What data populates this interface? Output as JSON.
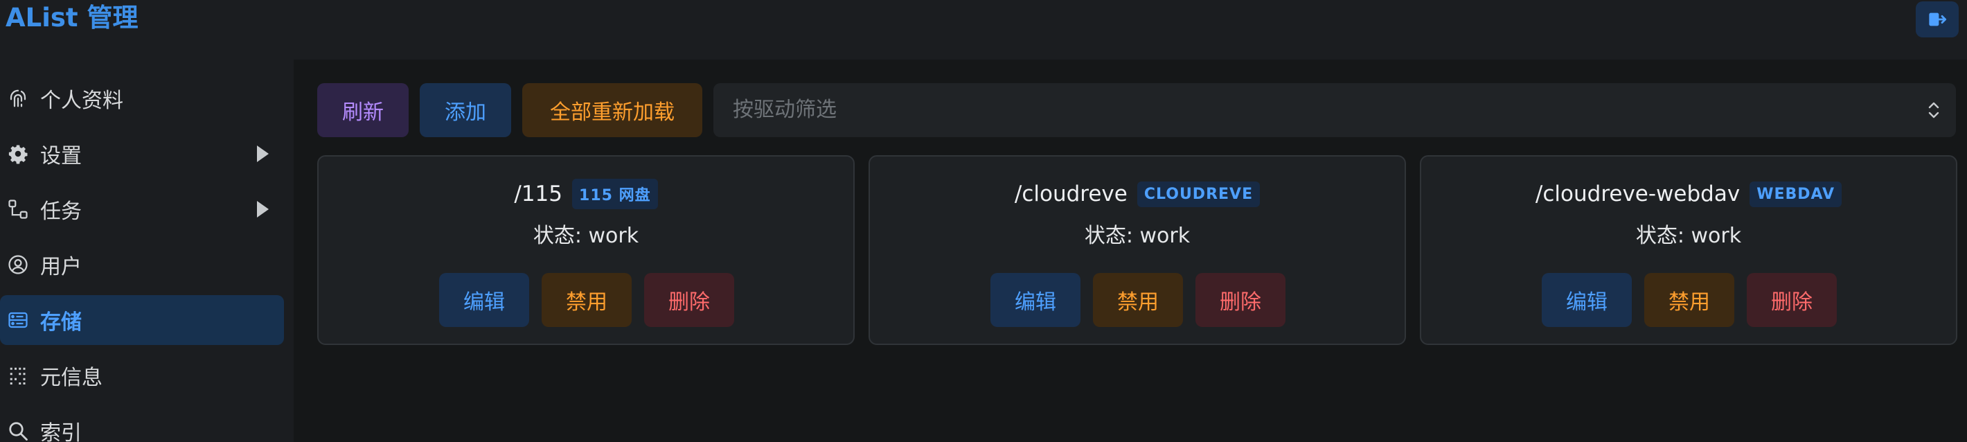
{
  "header": {
    "title": "AList 管理",
    "logout_icon": "logout-icon"
  },
  "sidebar": {
    "items": [
      {
        "label": "个人资料",
        "icon": "fingerprint-icon",
        "has_submenu": false,
        "active": false
      },
      {
        "label": "设置",
        "icon": "gear-icon",
        "has_submenu": true,
        "active": false
      },
      {
        "label": "任务",
        "icon": "task-flow-icon",
        "has_submenu": true,
        "active": false
      },
      {
        "label": "用户",
        "icon": "user-icon",
        "has_submenu": false,
        "active": false
      },
      {
        "label": "存储",
        "icon": "storage-icon",
        "has_submenu": false,
        "active": true
      },
      {
        "label": "元信息",
        "icon": "metadata-icon",
        "has_submenu": false,
        "active": false
      },
      {
        "label": "索引",
        "icon": "search-icon",
        "has_submenu": false,
        "active": false
      }
    ]
  },
  "toolbar": {
    "refresh_label": "刷新",
    "add_label": "添加",
    "reload_all_label": "全部重新加载",
    "driver_filter_placeholder": "按驱动筛选"
  },
  "storages": [
    {
      "path": "/115",
      "driver": "115 网盘",
      "status": "状态: work",
      "edit_label": "编辑",
      "disable_label": "禁用",
      "delete_label": "删除"
    },
    {
      "path": "/cloudreve",
      "driver": "CLOUDREVE",
      "status": "状态: work",
      "edit_label": "编辑",
      "disable_label": "禁用",
      "delete_label": "删除"
    },
    {
      "path": "/cloudreve-webdav",
      "driver": "WEBDAV",
      "status": "状态: work",
      "edit_label": "编辑",
      "disable_label": "禁用",
      "delete_label": "删除"
    }
  ],
  "colors": {
    "accent": "#3d8fe8",
    "active_bg": "#17314f",
    "purple": "#b58cff",
    "orange": "#ff9f2e",
    "red": "#ff6b6b"
  }
}
